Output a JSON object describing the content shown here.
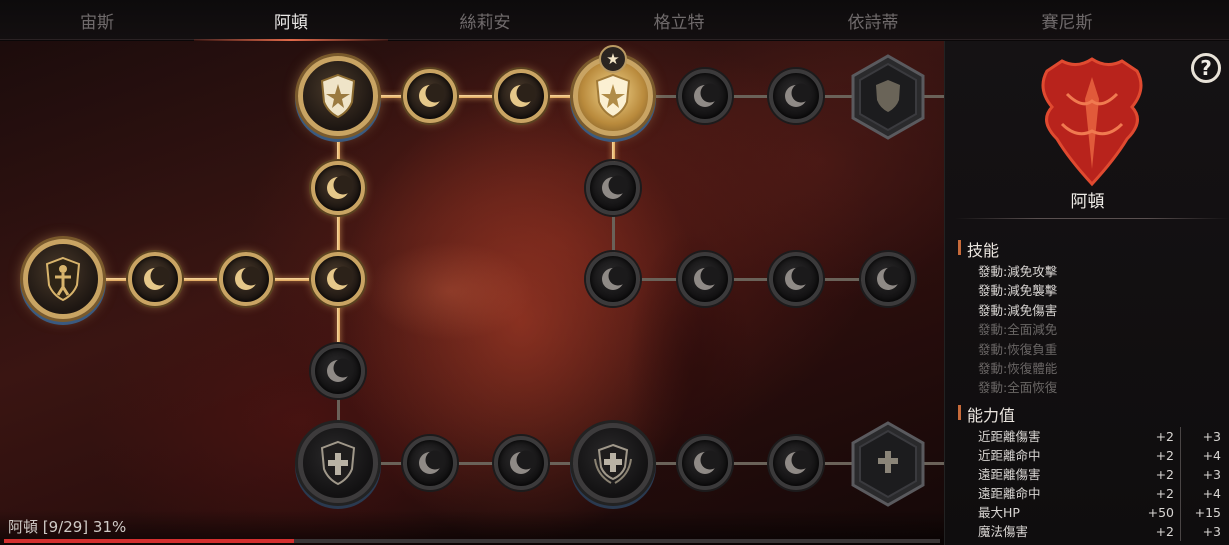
{
  "tabs": [
    {
      "label": "宙斯",
      "active": false
    },
    {
      "label": "阿頓",
      "active": true
    },
    {
      "label": "絲莉安",
      "active": false
    },
    {
      "label": "格立特",
      "active": false
    },
    {
      "label": "依詩蒂",
      "active": false
    },
    {
      "label": "賽尼斯",
      "active": false
    }
  ],
  "progress": {
    "text": "阿頓 [9/29] 31%",
    "percent": 31
  },
  "panel": {
    "help_icon": "?",
    "character_name": "阿頓",
    "skills_title": "技能",
    "skills": [
      {
        "label": "發動:減免攻擊",
        "active": true
      },
      {
        "label": "發動:減免襲擊",
        "active": true
      },
      {
        "label": "發動:減免傷害",
        "active": true
      },
      {
        "label": "發動:全面減免",
        "active": false
      },
      {
        "label": "發動:恢復負重",
        "active": false
      },
      {
        "label": "發動:恢復體能",
        "active": false
      },
      {
        "label": "發動:全面恢復",
        "active": false
      }
    ],
    "stats_title": "能力值",
    "stats": [
      {
        "name": "近距離傷害",
        "current": "+2",
        "next": "+3"
      },
      {
        "name": "近距離命中",
        "current": "+2",
        "next": "+4"
      },
      {
        "name": "遠距離傷害",
        "current": "+2",
        "next": "+3"
      },
      {
        "name": "遠距離命中",
        "current": "+2",
        "next": "+4"
      },
      {
        "name": "最大HP",
        "current": "+50",
        "next": "+15"
      },
      {
        "name": "魔法傷害",
        "current": "+2",
        "next": "+3"
      }
    ]
  },
  "colors": {
    "accent": "#d42f2f",
    "node_active": "#c9a463",
    "node_inactive": "#3b3a3b"
  }
}
